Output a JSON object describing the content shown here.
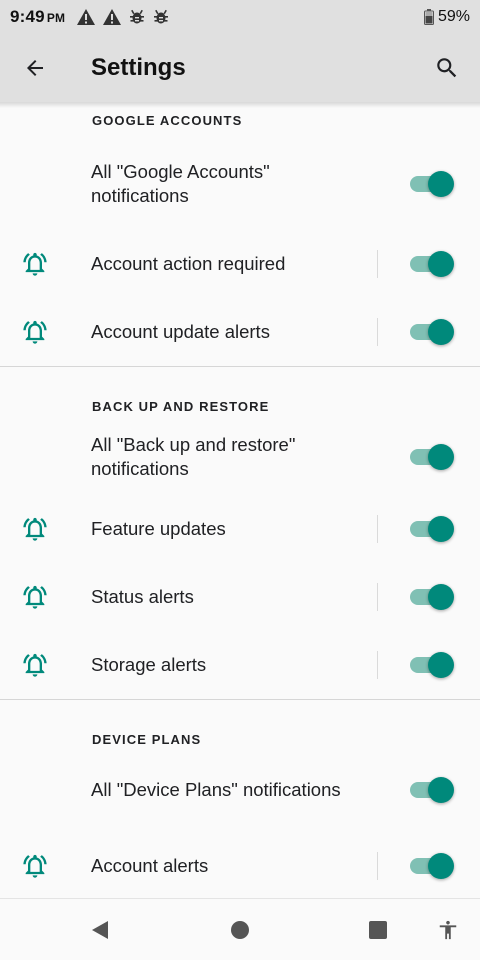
{
  "status_bar": {
    "time": "9:49",
    "ampm": "PM",
    "battery": "59%",
    "icons": [
      "warning-icon",
      "warning-icon",
      "bug-icon",
      "bug-icon",
      "battery-icon"
    ]
  },
  "app_bar": {
    "title": "Settings",
    "back_icon": "arrow-back-icon",
    "search_icon": "search-icon"
  },
  "accent_color": "#00897b",
  "sections": [
    {
      "header": "GOOGLE ACCOUNTS",
      "all_label": "All \"Google Accounts\" notifications",
      "items": [
        {
          "label": "Account action required",
          "icon": "notification-bell-icon",
          "enabled": true
        },
        {
          "label": "Account update alerts",
          "icon": "notification-bell-icon",
          "enabled": true
        }
      ]
    },
    {
      "header": "BACK UP AND RESTORE",
      "all_label": "All \"Back up and restore\" notifications",
      "items": [
        {
          "label": "Feature updates",
          "icon": "notification-bell-icon",
          "enabled": true
        },
        {
          "label": "Status alerts",
          "icon": "notification-bell-icon",
          "enabled": true
        },
        {
          "label": "Storage alerts",
          "icon": "notification-bell-icon",
          "enabled": true
        }
      ]
    },
    {
      "header": "DEVICE PLANS",
      "all_label": "All \"Device Plans\" notifications",
      "items": [
        {
          "label": "Account alerts",
          "icon": "notification-bell-icon",
          "enabled": true
        }
      ]
    }
  ],
  "nav_bar": {
    "icons": [
      "back-triangle-icon",
      "home-circle-icon",
      "recents-square-icon",
      "accessibility-icon"
    ]
  }
}
